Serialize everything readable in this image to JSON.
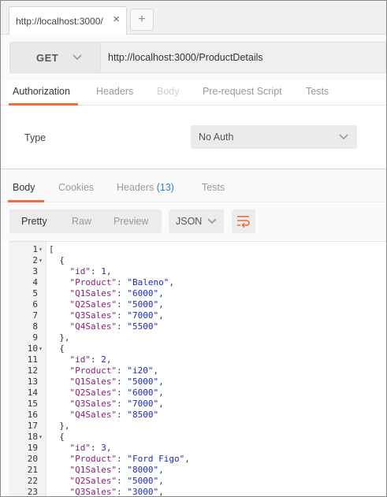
{
  "tab": {
    "title": "http://localhost:3000/",
    "close": "×",
    "add": "+"
  },
  "request": {
    "method": "GET",
    "url": "http://localhost:3000/ProductDetails",
    "tabs": [
      "Authorization",
      "Headers",
      "Body",
      "Pre-request Script",
      "Tests"
    ]
  },
  "auth": {
    "type_label": "Type",
    "selected": "No Auth"
  },
  "response": {
    "tabs": {
      "body": "Body",
      "cookies": "Cookies",
      "headers": "Headers",
      "headers_count": "(13)",
      "tests": "Tests"
    },
    "view_modes": [
      "Pretty",
      "Raw",
      "Preview"
    ],
    "format": "JSON"
  },
  "code_lines": [
    [
      "[",
      "",
      "",
      ""
    ],
    [
      "  {",
      "",
      "",
      ""
    ],
    [
      "    ",
      "\"id\"",
      ": ",
      "1,"
    ],
    [
      "    ",
      "\"Product\"",
      ": ",
      "\"Baleno\","
    ],
    [
      "    ",
      "\"Q1Sales\"",
      ": ",
      "\"6000\","
    ],
    [
      "    ",
      "\"Q2Sales\"",
      ": ",
      "\"5000\","
    ],
    [
      "    ",
      "\"Q3Sales\"",
      ": ",
      "\"7000\","
    ],
    [
      "    ",
      "\"Q4Sales\"",
      ": ",
      "\"5500\""
    ],
    [
      "  },",
      "",
      "",
      ""
    ],
    [
      "  {",
      "",
      "",
      ""
    ],
    [
      "    ",
      "\"id\"",
      ": ",
      "2,"
    ],
    [
      "    ",
      "\"Product\"",
      ": ",
      "\"i20\","
    ],
    [
      "    ",
      "\"Q1Sales\"",
      ": ",
      "\"5000\","
    ],
    [
      "    ",
      "\"Q2Sales\"",
      ": ",
      "\"6000\","
    ],
    [
      "    ",
      "\"Q3Sales\"",
      ": ",
      "\"7000\","
    ],
    [
      "    ",
      "\"Q4Sales\"",
      ": ",
      "\"8500\""
    ],
    [
      "  },",
      "",
      "",
      ""
    ],
    [
      "  {",
      "",
      "",
      ""
    ],
    [
      "    ",
      "\"id\"",
      ": ",
      "3,"
    ],
    [
      "    ",
      "\"Product\"",
      ": ",
      "\"Ford Figo\","
    ],
    [
      "    ",
      "\"Q1Sales\"",
      ": ",
      "\"8000\","
    ],
    [
      "    ",
      "\"Q2Sales\"",
      ": ",
      "\"5000\","
    ],
    [
      "    ",
      "\"Q3Sales\"",
      ": ",
      "\"3000\","
    ]
  ],
  "fold_lines": [
    1,
    2,
    10,
    18
  ],
  "colors": {
    "accent": "#f26b3a",
    "key": "#8a1d7a",
    "value": "#1b2bb8",
    "count": "#2f7fcf"
  }
}
